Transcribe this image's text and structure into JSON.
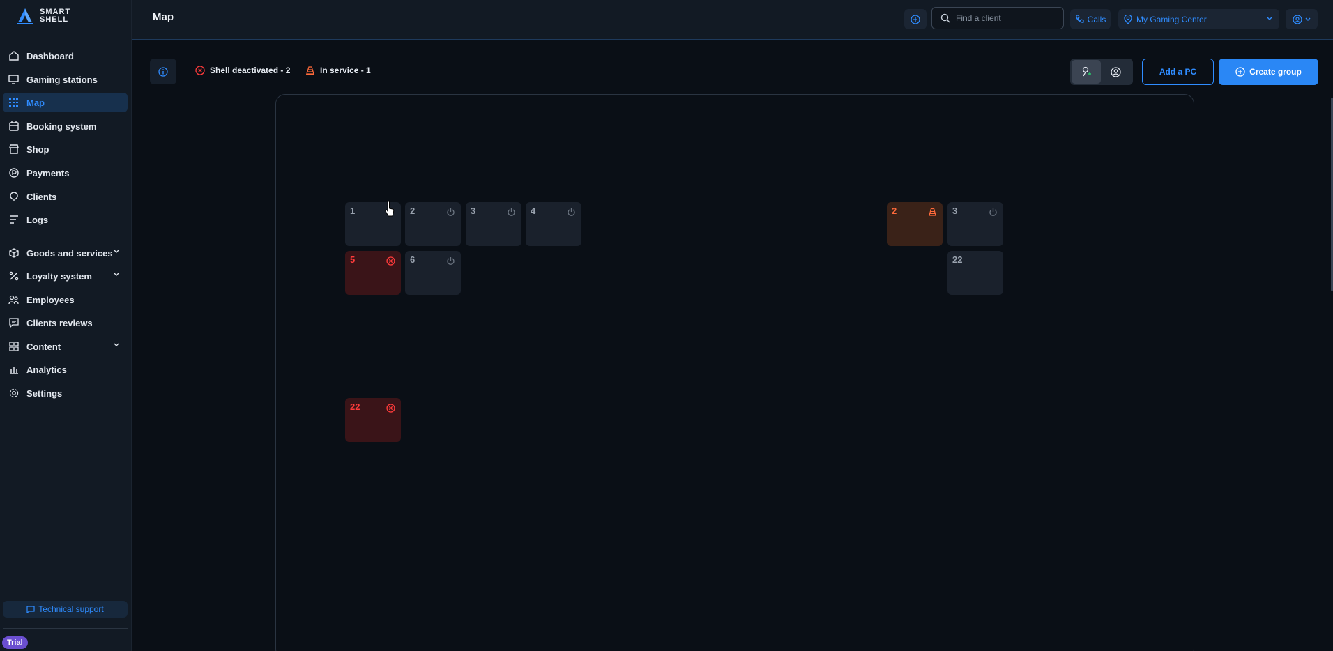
{
  "app": {
    "logo_line1": "SMART",
    "logo_line2": "SHELL"
  },
  "header": {
    "title": "Map",
    "search_placeholder": "Find a client",
    "calls_label": "Calls",
    "center_name": "My Gaming Center"
  },
  "sidebar": {
    "items": [
      {
        "label": "Dashboard",
        "icon": "home-icon"
      },
      {
        "label": "Gaming stations",
        "icon": "monitor-icon"
      },
      {
        "label": "Map",
        "icon": "map-grid-icon",
        "active": true
      },
      {
        "label": "Booking system",
        "icon": "calendar-icon"
      },
      {
        "label": "Shop",
        "icon": "store-icon"
      },
      {
        "label": "Payments",
        "icon": "payment-icon"
      },
      {
        "label": "Clients",
        "icon": "clients-icon"
      },
      {
        "label": "Logs",
        "icon": "logs-icon"
      },
      {
        "label": "Goods and services",
        "icon": "box-icon",
        "expandable": true
      },
      {
        "label": "Loyalty system",
        "icon": "percent-icon",
        "expandable": true
      },
      {
        "label": "Employees",
        "icon": "employees-icon"
      },
      {
        "label": "Clients reviews",
        "icon": "reviews-icon"
      },
      {
        "label": "Content",
        "icon": "grid-icon",
        "expandable": true
      },
      {
        "label": "Analytics",
        "icon": "analytics-icon"
      },
      {
        "label": "Settings",
        "icon": "gear-icon"
      }
    ],
    "support_label": "Technical support",
    "trial_label": "Trial"
  },
  "toolbar": {
    "legend_deactivated": "Shell deactivated - 2",
    "legend_service": "In service - 1",
    "add_pc_label": "Add a PC",
    "create_group_label": "Create group"
  },
  "colors": {
    "accent": "#2a87f5",
    "deactivated": "#ff3b3b",
    "in_service": "#ff6a3b"
  },
  "map": {
    "pcs": [
      {
        "number": "1",
        "status": "idle"
      },
      {
        "number": "2",
        "status": "off"
      },
      {
        "number": "3",
        "status": "off"
      },
      {
        "number": "4",
        "status": "off"
      },
      {
        "number": "5",
        "status": "deactivated"
      },
      {
        "number": "6",
        "status": "off"
      },
      {
        "number": "22",
        "status": "deactivated"
      },
      {
        "number": "2",
        "status": "in_service"
      },
      {
        "number": "3",
        "status": "off"
      },
      {
        "number": "22",
        "status": "idle"
      }
    ]
  }
}
